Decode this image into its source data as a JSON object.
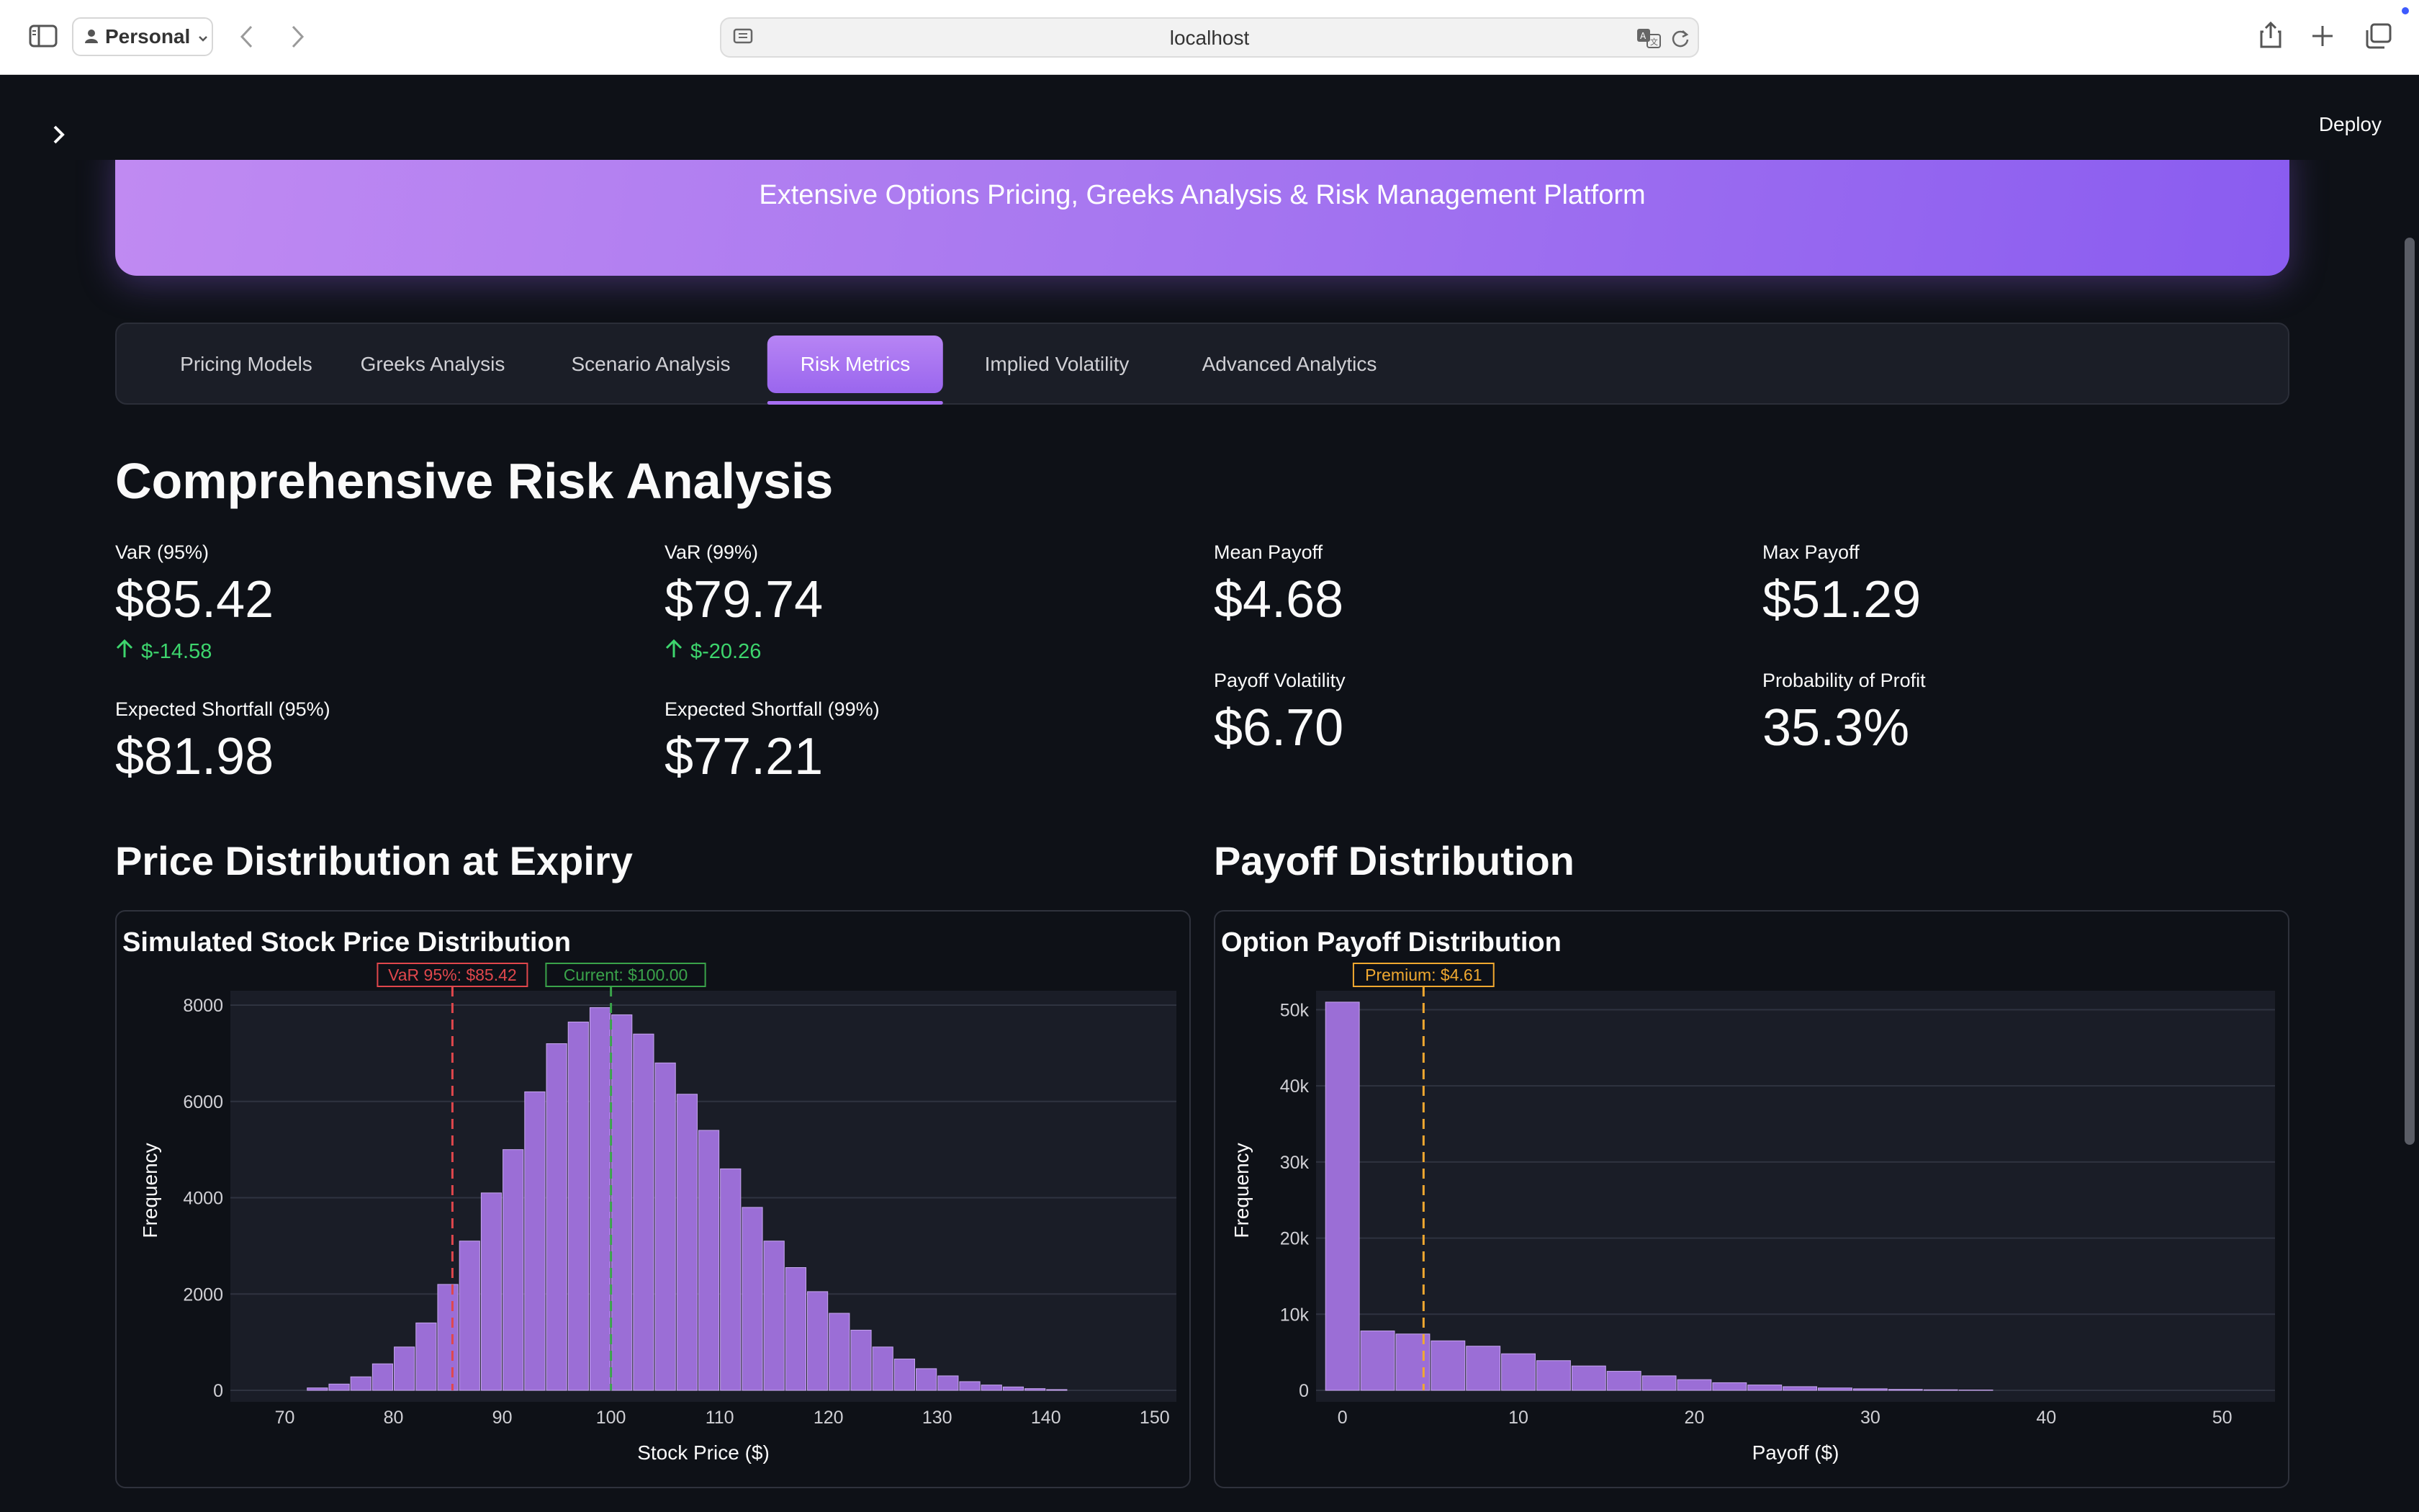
{
  "browser": {
    "profile": "Personal",
    "url": "localhost"
  },
  "header": {
    "deploy_label": "Deploy"
  },
  "hero": {
    "subtitle": "Extensive Options Pricing, Greeks Analysis & Risk Management Platform"
  },
  "tabs": [
    {
      "label": "Pricing Models",
      "active": false
    },
    {
      "label": "Greeks Analysis",
      "active": false
    },
    {
      "label": "Scenario Analysis",
      "active": false
    },
    {
      "label": "Risk Metrics",
      "active": true
    },
    {
      "label": "Implied Volatility",
      "active": false
    },
    {
      "label": "Advanced Analytics",
      "active": false
    }
  ],
  "section_title": "Comprehensive Risk Analysis",
  "metrics": {
    "var95": {
      "label": "VaR (95%)",
      "value": "$85.42",
      "delta": "$-14.58"
    },
    "var99": {
      "label": "VaR (99%)",
      "value": "$79.74",
      "delta": "$-20.26"
    },
    "mean_payoff": {
      "label": "Mean Payoff",
      "value": "$4.68"
    },
    "max_payoff": {
      "label": "Max Payoff",
      "value": "$51.29"
    },
    "es95": {
      "label": "Expected Shortfall (95%)",
      "value": "$81.98"
    },
    "es99": {
      "label": "Expected Shortfall (99%)",
      "value": "$77.21"
    },
    "payoff_vol": {
      "label": "Payoff Volatility",
      "value": "$6.70"
    },
    "prob_profit": {
      "label": "Probability of Profit",
      "value": "35.3%"
    }
  },
  "headings": {
    "price_dist": "Price Distribution at Expiry",
    "payoff_dist": "Payoff Distribution"
  },
  "colors": {
    "accent": "#9d6ef0",
    "bar": "#9b6ed6",
    "var_line": "#e0474c",
    "current_line": "#3aa34a",
    "premium_line": "#f0a830",
    "positive": "#3dd56d"
  },
  "chart_data": [
    {
      "type": "bar",
      "title": "Simulated Stock Price Distribution",
      "xlabel": "Stock Price ($)",
      "ylabel": "Frequency",
      "xlim": [
        65,
        152
      ],
      "ylim": [
        0,
        8300
      ],
      "xticks": [
        70,
        80,
        90,
        100,
        110,
        120,
        130,
        140,
        150
      ],
      "yticks": [
        0,
        2000,
        4000,
        6000,
        8000
      ],
      "bin_width": 2,
      "bin_starts": [
        72,
        74,
        76,
        78,
        80,
        82,
        84,
        86,
        88,
        90,
        92,
        94,
        96,
        98,
        100,
        102,
        104,
        106,
        108,
        110,
        112,
        114,
        116,
        118,
        120,
        122,
        124,
        126,
        128,
        130,
        132,
        134,
        136,
        138,
        140
      ],
      "values": [
        50,
        130,
        280,
        550,
        900,
        1400,
        2200,
        3100,
        4100,
        5000,
        6200,
        7200,
        7650,
        7950,
        7800,
        7400,
        6800,
        6150,
        5400,
        4600,
        3800,
        3100,
        2550,
        2050,
        1600,
        1250,
        900,
        650,
        450,
        300,
        180,
        110,
        70,
        35,
        15
      ],
      "grid": true,
      "annotations": [
        {
          "label": "VaR 95%: $85.42",
          "x": 85.42,
          "color": "#e0474c"
        },
        {
          "label": "Current: $100.00",
          "x": 100.0,
          "color": "#3aa34a"
        }
      ]
    },
    {
      "type": "bar",
      "title": "Option Payoff Distribution",
      "xlabel": "Payoff ($)",
      "ylabel": "Frequency",
      "xlim": [
        -1.5,
        53
      ],
      "ylim": [
        0,
        52500
      ],
      "xticks": [
        0,
        10,
        20,
        30,
        40,
        50
      ],
      "yticks": [
        0,
        10000,
        20000,
        30000,
        40000,
        50000
      ],
      "ytick_labels": [
        "0",
        "10k",
        "20k",
        "30k",
        "40k",
        "50k"
      ],
      "bin_width": 2,
      "bin_starts": [
        -1,
        1,
        3,
        5,
        7,
        9,
        11,
        13,
        15,
        17,
        19,
        21,
        23,
        25,
        27,
        29,
        31,
        33,
        35
      ],
      "values": [
        51000,
        7800,
        7400,
        6500,
        5800,
        4800,
        3900,
        3200,
        2500,
        1900,
        1400,
        1000,
        700,
        480,
        310,
        200,
        120,
        70,
        40
      ],
      "grid": true,
      "annotations": [
        {
          "label": "Premium: $4.61",
          "x": 4.61,
          "color": "#f0a830"
        }
      ]
    }
  ]
}
